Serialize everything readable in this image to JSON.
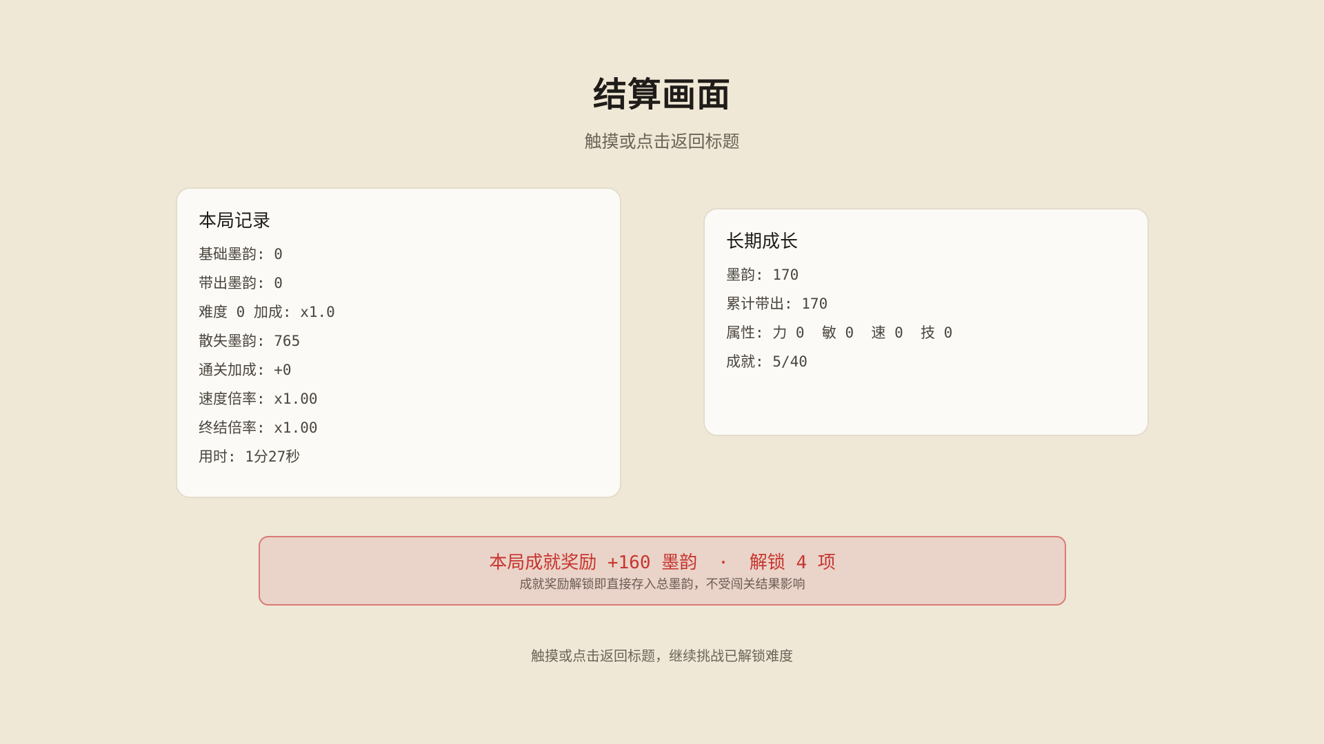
{
  "screen": {
    "title": "结算画面",
    "subtitle": "触摸或点击返回标题",
    "footer": "触摸或点击返回标题，继续挑战已解锁难度"
  },
  "run_record": {
    "title": "本局记录",
    "stats": [
      "基础墨韵: 0",
      "带出墨韵: 0",
      "难度 0 加成: x1.0",
      "散失墨韵: 765",
      "通关加成: +0",
      "速度倍率: x1.00",
      "终结倍率: x1.00",
      "用时: 1分27秒"
    ]
  },
  "growth": {
    "title": "长期成长",
    "stats": [
      "墨韵: 170",
      "累计带出: 170",
      "属性: 力 0  敏 0  速 0  技 0",
      "成就: 5/40"
    ]
  },
  "reward": {
    "main_left": "本局成就奖励 +160 墨韵",
    "separator": "·",
    "main_right": "解锁 4 项",
    "note": "成就奖励解锁即直接存入总墨韵，不受闯关结果影响"
  },
  "colors": {
    "background": "#f0e8d6",
    "card": "#fbfaf6",
    "reward_text": "#c7352f",
    "reward_border": "#d97a74",
    "reward_bg": "#ead3c8"
  }
}
